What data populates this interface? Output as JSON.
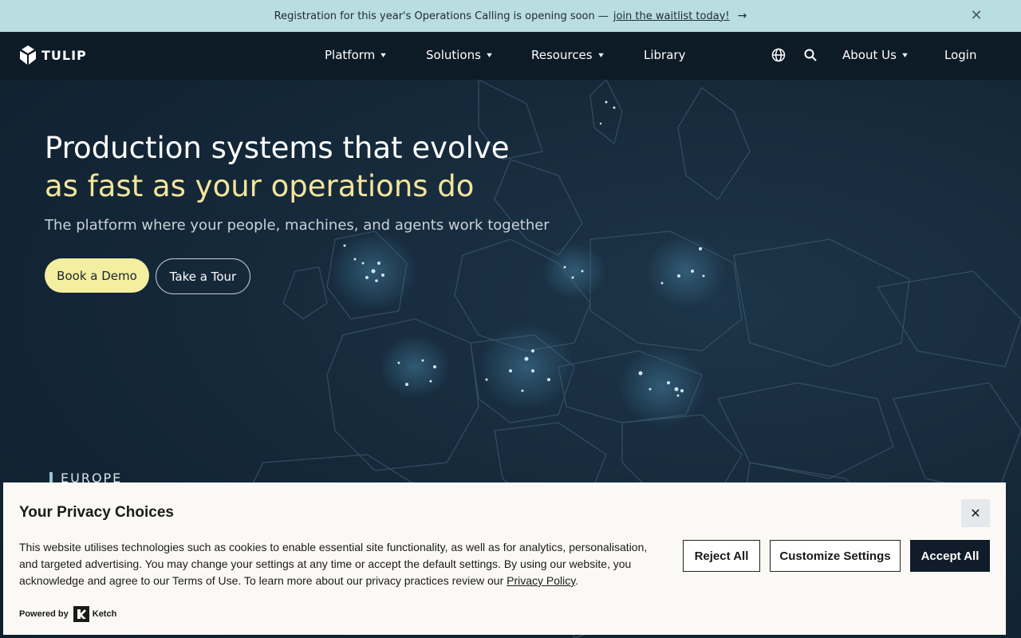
{
  "announcement": {
    "text": "Registration for this year's Operations Calling is opening soon —",
    "link": "join the waitlist today!",
    "arrow": "→",
    "close": "✕"
  },
  "nav": {
    "logo": "TULIP",
    "items": [
      {
        "label": "Platform",
        "chevron": "▾"
      },
      {
        "label": "Solutions",
        "chevron": "▾"
      },
      {
        "label": "Resources",
        "chevron": "▾"
      },
      {
        "label": "Library"
      }
    ],
    "about": "About Us",
    "about_chevron": "▾",
    "login": "Login",
    "icons": [
      "globe-icon",
      "search-icon"
    ]
  },
  "hero": {
    "title_line1": "Production systems that evolve",
    "title_line2": "as fast as your operations do",
    "subtitle": "The platform where your people, machines, and agents work together",
    "primary_cta": "Book a Demo",
    "secondary_cta": "Take a Tour",
    "region_label": "EUROPE",
    "accent_color": "#f2e59a"
  },
  "privacy": {
    "title": "Your Privacy Choices",
    "close": "✕",
    "body": "This website utilises technologies such as cookies to enable essential site functionality, as well as for analytics, personalisation, and targeted advertising. You may change your settings at any time or accept the default settings. By using our website, you acknowledge and agree to our Terms of Use. To learn more about our privacy practices review our",
    "policy_link": "Privacy Policy",
    "policy_period": ".",
    "reject": "Reject All",
    "customize": "Customize Settings",
    "accept": "Accept All",
    "powered_by": "Powered by",
    "brand": "Ketch"
  }
}
